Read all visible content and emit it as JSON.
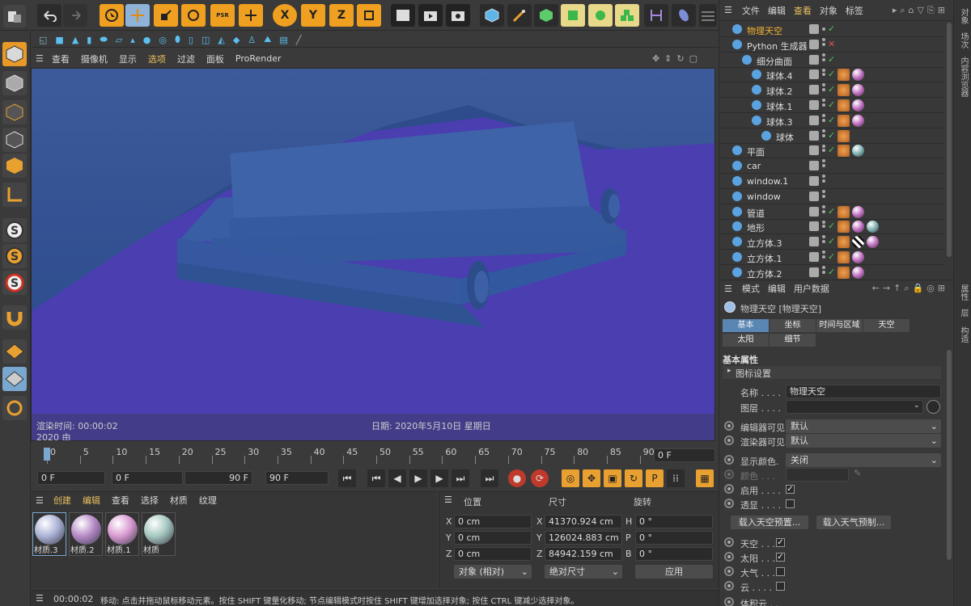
{
  "top_toolbar": {
    "undo": "undo-icon",
    "redo": "redo-icon",
    "psr": "PSR",
    "x": "X",
    "y": "Y",
    "z": "Z"
  },
  "object_manager": {
    "menu": [
      "文件",
      "编辑",
      "查看",
      "对象",
      "标签"
    ],
    "objects": [
      {
        "name": "物理天空",
        "indent": 0,
        "highlight": true
      },
      {
        "name": "Python 生成器",
        "indent": 0
      },
      {
        "name": "细分曲面",
        "indent": 1
      },
      {
        "name": "球体.4",
        "indent": 2
      },
      {
        "name": "球体.2",
        "indent": 2
      },
      {
        "name": "球体.1",
        "indent": 2
      },
      {
        "name": "球体.3",
        "indent": 2
      },
      {
        "name": "球体",
        "indent": 3
      },
      {
        "name": "平面",
        "indent": 0
      },
      {
        "name": "car",
        "indent": 0
      },
      {
        "name": "window.1",
        "indent": 0
      },
      {
        "name": "window",
        "indent": 0
      },
      {
        "name": "管道",
        "indent": 0
      },
      {
        "name": "地形",
        "indent": 0
      },
      {
        "name": "立方体.3",
        "indent": 0
      },
      {
        "name": "立方体.1",
        "indent": 0
      },
      {
        "name": "立方体.2",
        "indent": 0
      }
    ],
    "side_tabs": [
      "对象",
      "场次",
      "内容浏览器"
    ]
  },
  "viewport": {
    "menu": [
      "查看",
      "摄像机",
      "显示",
      "选项",
      "过滤",
      "面板",
      "ProRender"
    ],
    "render_time": "渲染时间: 00:00:02",
    "year": "2020 由",
    "date": "日期: 2020年5月10日 星期日"
  },
  "timeline": {
    "ticks": [
      "0",
      "5",
      "10",
      "15",
      "20",
      "25",
      "30",
      "35",
      "40",
      "45",
      "50",
      "55",
      "60",
      "65",
      "70",
      "75",
      "80",
      "85",
      "90"
    ],
    "current_frame": "0 F",
    "start": "0 F",
    "range_start": "0 F",
    "range_end": "90 F",
    "end": "90 F"
  },
  "material_manager": {
    "menu": [
      "创建",
      "编辑",
      "查看",
      "选择",
      "材质",
      "纹理"
    ],
    "materials": [
      {
        "name": "材质.3",
        "color": "#aab3d6"
      },
      {
        "name": "材质.2",
        "color": "#b68ac7"
      },
      {
        "name": "材质.1",
        "color": "#d99ad0"
      },
      {
        "name": "材质",
        "color": "#a5c7c0"
      }
    ]
  },
  "coordinates": {
    "headers": [
      "位置",
      "尺寸",
      "旋转"
    ],
    "rows": [
      {
        "axis": "X",
        "pos": "0 cm",
        "size_axis": "X",
        "size": "41370.924 cm",
        "rot_axis": "H",
        "rot": "0 °"
      },
      {
        "axis": "Y",
        "pos": "0 cm",
        "size_axis": "Y",
        "size": "126024.883 cm",
        "rot_axis": "P",
        "rot": "0 °"
      },
      {
        "axis": "Z",
        "pos": "0 cm",
        "size_axis": "Z",
        "size": "84942.159 cm",
        "rot_axis": "B",
        "rot": "0 °"
      }
    ],
    "mode": "对象 (相对)",
    "size_mode": "绝对尺寸",
    "apply": "应用"
  },
  "attributes": {
    "menu": [
      "模式",
      "编辑",
      "用户数据"
    ],
    "title": "物理天空 [物理天空]",
    "tabs_row1": [
      "基本",
      "坐标",
      "时间与区域",
      "天空"
    ],
    "tabs_row2": [
      "太阳",
      "细节"
    ],
    "section": "基本属性",
    "icon_settings": "图标设置",
    "name_label": "名称 . . . .",
    "name_value": "物理天空",
    "layer_label": "图层 . . . .",
    "editor_visible_label": "编辑器可见",
    "editor_visible_value": "默认",
    "render_visible_label": "渲染器可见",
    "render_visible_value": "默认",
    "display_color_label": "显示颜色.",
    "display_color_value": "关闭",
    "color_label": "颜色 . . .",
    "enable_label": "启用 . . . .",
    "transparency_label": "透显 . . . .",
    "load_sky_preset": "载入天空预置...",
    "load_weather_preset": "载入天气预制...",
    "sky_label": "天空 . . .",
    "sun_label": "太阳 . . .",
    "atmosphere_label": "大气 . . .",
    "cloud_label": "云 . . . .",
    "more_label": "体积云 . .",
    "side_tabs": [
      "属性",
      "层",
      "构造"
    ]
  },
  "status_bar": {
    "time": "00:00:02",
    "message": "移动: 点击并拖动鼠标移动元素。按住 SHIFT 键量化移动; 节点编辑模式时按住 SHIFT 键增加选择对象; 按住 CTRL 键减少选择对象。"
  }
}
